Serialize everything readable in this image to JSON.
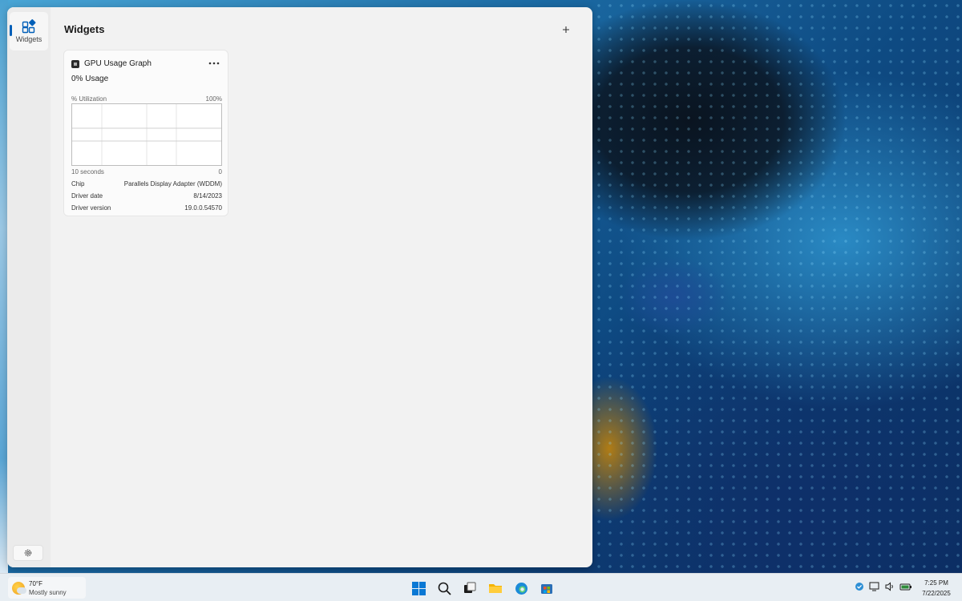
{
  "panel": {
    "title": "Widgets",
    "rail": {
      "widgets_label": "Widgets"
    }
  },
  "gpu_widget": {
    "title": "GPU Usage Graph",
    "usage": "0% Usage",
    "graph": {
      "y_label": "% Utilization",
      "y_max_label": "100%",
      "x_left_label": "10 seconds",
      "x_right_label": "0"
    },
    "info": [
      {
        "label": "Chip",
        "value": "Parallels Display Adapter (WDDM)"
      },
      {
        "label": "Driver date",
        "value": "8/14/2023"
      },
      {
        "label": "Driver version",
        "value": "19.0.0.54570"
      }
    ]
  },
  "taskbar": {
    "weather": {
      "temp": "70°F",
      "condition": "Mostly sunny"
    },
    "clock": {
      "time": "7:25 PM",
      "date": "7/22/2025"
    }
  },
  "colors": {
    "accent": "#005fb8",
    "panel_bg": "#f2f2f2",
    "taskbar_bg": "#e8eef3"
  }
}
